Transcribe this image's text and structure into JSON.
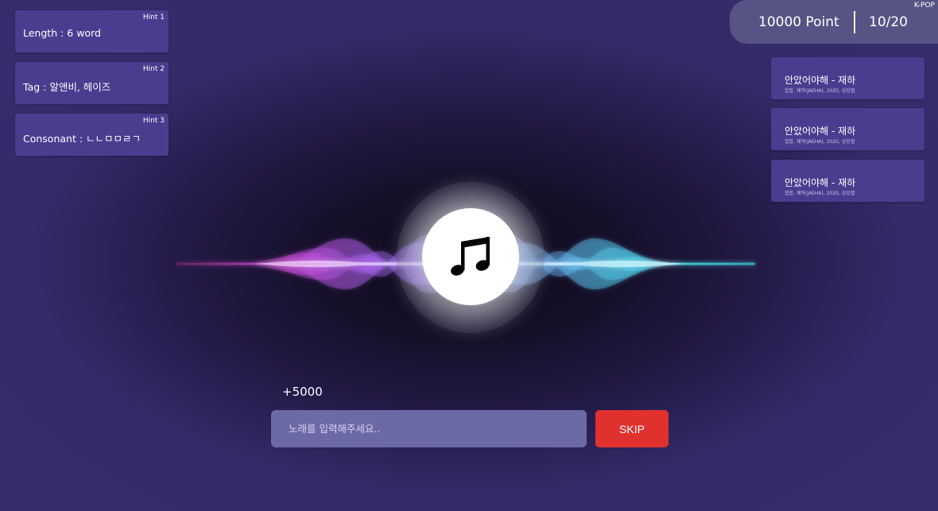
{
  "header": {
    "genre": "K-POP",
    "points": "10000 Point",
    "round": "10/20"
  },
  "hints": [
    {
      "tag": "Hint 1",
      "text": "Length : 6 word"
    },
    {
      "tag": "Hint 2",
      "text": "Tag : 알앤비, 헤이즈"
    },
    {
      "tag": "Hint 3",
      "text": "Consonant : ㄴㄴㅁㅁㄹㄱ"
    }
  ],
  "history": [
    {
      "title": "안았어야해 - 재하",
      "meta": "힙합, 재하(JAEHA), 2020, 싱잉랩"
    },
    {
      "title": "안았어야해 - 재하",
      "meta": "힙합, 재하(JAEHA), 2020, 싱잉랩"
    },
    {
      "title": "안았어야해 - 재하",
      "meta": "힙합, 재하(JAEHA), 2020, 싱잉랩"
    }
  ],
  "player": {
    "icon": "music-note-icon",
    "bonus": "+5000"
  },
  "answer": {
    "placeholder": "노래를 입력해주세요..",
    "value": "",
    "skip_label": "SKIP"
  },
  "colors": {
    "background": "#352a67",
    "card": "#4a3c8f",
    "score_panel": "#565484",
    "input": "#6b6aa6",
    "skip": "#e1312f",
    "wave_left": "#c76cf5",
    "wave_right": "#52d6f0"
  }
}
